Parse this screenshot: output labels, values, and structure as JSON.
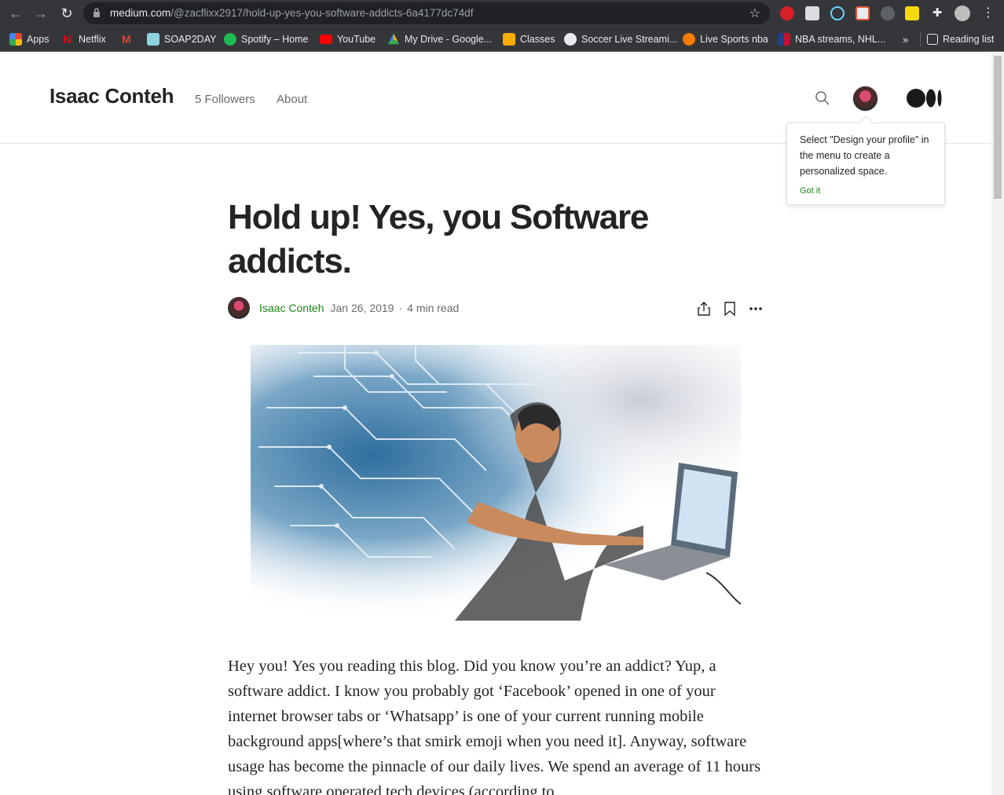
{
  "browser": {
    "url_domain": "medium.com",
    "url_path": "/@zacflixx2917/hold-up-yes-you-software-addicts-6a4177dc74df",
    "bookmarks": [
      {
        "label": "Apps"
      },
      {
        "label": "Netflix"
      },
      {
        "label": ""
      },
      {
        "label": "SOAP2DAY"
      },
      {
        "label": "Spotify – Home"
      },
      {
        "label": "YouTube"
      },
      {
        "label": "My Drive - Google..."
      },
      {
        "label": "Classes"
      },
      {
        "label": "Soccer Live Streami..."
      },
      {
        "label": "Live Sports nba"
      },
      {
        "label": "NBA streams, NHL..."
      }
    ],
    "overflow_label": "»",
    "reading_list": "Reading list"
  },
  "header": {
    "brand": "Isaac Conteh",
    "followers": "5 Followers",
    "about": "About"
  },
  "tooltip": {
    "text": "Select \"Design your profile\" in the menu to create a personalized space.",
    "button": "Got it"
  },
  "article": {
    "title": "Hold up! Yes, you Software addicts.",
    "author": "Isaac Conteh",
    "date": "Jan 26, 2019",
    "separator": "·",
    "read_time": "4 min read",
    "body": "Hey you! Yes you reading this blog. Did you know you’re an addict? Yup, a software addict. I know you probably got ‘Facebook’ opened in one of your internet browser tabs or ‘Whatsapp’ is one of your current running mobile background apps[where’s that smirk emoji when you need it]. Anyway, software usage has become the pinnacle of our daily lives. We spend an average of 11 hours using software operated tech devices (according to"
  },
  "colors": {
    "accent": "#1a8917",
    "text": "#242424",
    "muted": "#6b6b6b",
    "chrome": "#35363a"
  }
}
